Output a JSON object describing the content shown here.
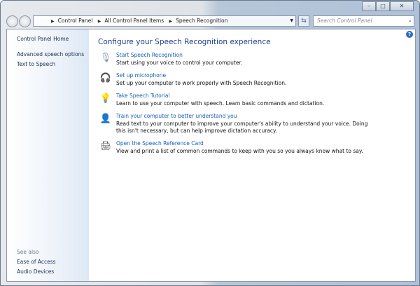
{
  "window": {
    "minimize": "–",
    "maximize": "□",
    "close": "✕"
  },
  "address": {
    "crumbs": [
      "Control Panel",
      "All Control Panel Items",
      "Speech Recognition"
    ]
  },
  "search": {
    "placeholder": "Search Control Panel"
  },
  "sidebar": {
    "home": "Control Panel Home",
    "links": [
      "Advanced speech options",
      "Text to Speech"
    ],
    "see_also": "See also",
    "see_also_links": [
      "Ease of Access",
      "Audio Devices"
    ]
  },
  "main": {
    "title": "Configure your Speech Recognition experience",
    "items": [
      {
        "icon": "microphone-icon",
        "link": "Start Speech Recognition",
        "desc": "Start using your voice to control your computer."
      },
      {
        "icon": "headset-icon",
        "link": "Set up microphone",
        "desc": "Set up your computer to work properly with Speech Recognition."
      },
      {
        "icon": "lightbulb-icon",
        "link": "Take Speech Tutorial",
        "desc": "Learn to use your computer with speech.  Learn basic commands and dictation."
      },
      {
        "icon": "user-train-icon",
        "link": "Train your computer to better understand you",
        "desc": "Read text to your computer to improve your computer's ability to understand your voice.  Doing this isn't necessary, but can help improve dictation accuracy."
      },
      {
        "icon": "printer-icon",
        "link": "Open the Speech Reference Card",
        "desc": "View and print a list of common commands to keep with you so you always know what to say."
      }
    ]
  }
}
